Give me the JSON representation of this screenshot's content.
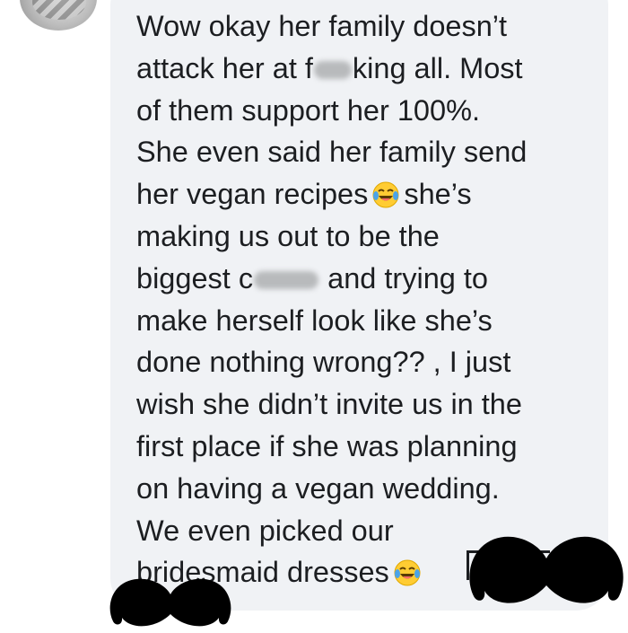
{
  "comment": {
    "lines": [
      "Wow okay her family doesn’t",
      {
        "before": "attack her at f",
        "after": "king all. Most"
      },
      "of them support her 100%.",
      "She even said her family send",
      {
        "before": "her vegan recipes",
        "after": "she’s"
      },
      "making us out to be the",
      {
        "before": "biggest c",
        "after": "and trying to"
      },
      "make herself look like she’s",
      "done nothing wrong?? , I just",
      "wish she didn’t invite us in the",
      "first place if she was planning",
      "on having a vegan wedding.",
      "We even picked our",
      {
        "before": "bridesmaid dresses"
      }
    ]
  },
  "emoji": {
    "name": "face-with-tears-of-joy-icon"
  },
  "colors": {
    "bubble": "#f0f2f5",
    "text": "#1c1e21",
    "emoji_face": "#ffcc33",
    "emoji_tears": "#4aa3e8",
    "redaction": "#000000"
  }
}
